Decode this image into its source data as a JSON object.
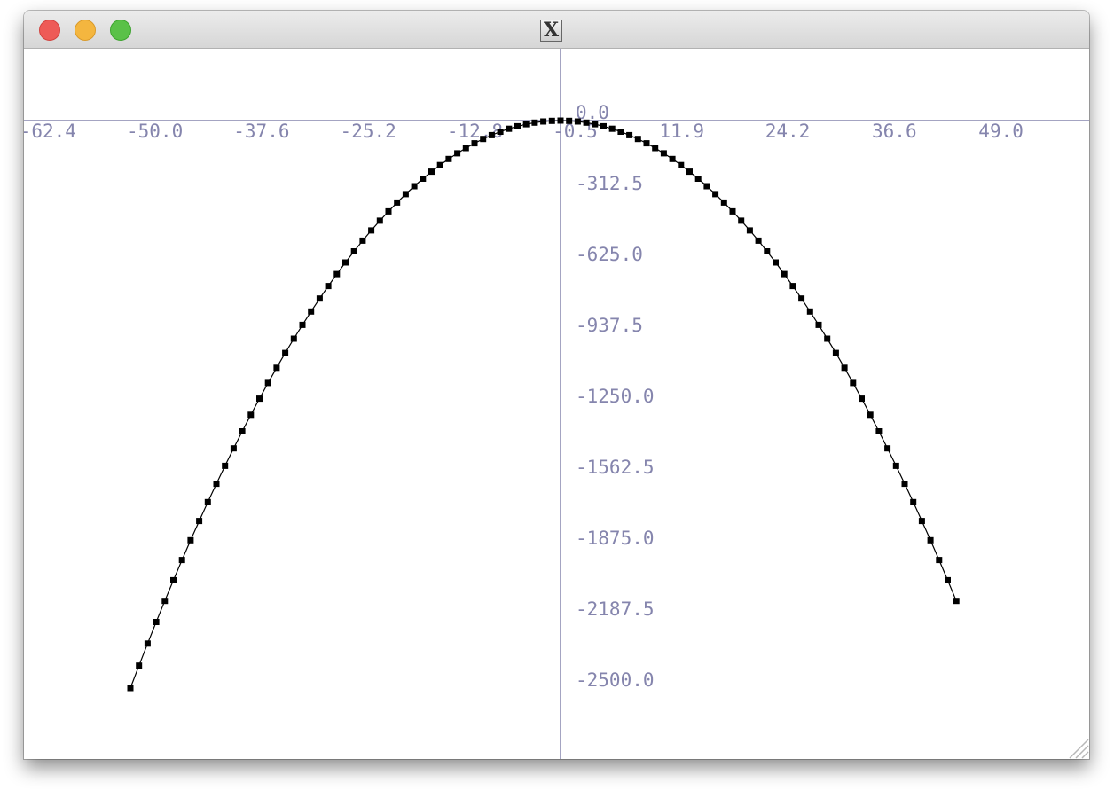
{
  "window": {
    "title_icon_text": "X"
  },
  "colors": {
    "axis": "#8585ad",
    "curve": "#000000",
    "background": "#ffffff"
  },
  "chart_data": {
    "type": "line",
    "title": "",
    "xlabel": "",
    "ylabel": "",
    "xlim": [
      -62.4,
      61.4
    ],
    "ylim": [
      -2700,
      250
    ],
    "grid": false,
    "legend": "none",
    "x_tick_values": [
      -62.4,
      -50.0,
      -37.6,
      -25.2,
      -12.8,
      -0.5,
      11.9,
      24.2,
      36.6,
      49.0
    ],
    "x_tick_labels": [
      "-62.4",
      "-50.0",
      "-37.6",
      "-25.2",
      "-12.8",
      "-0.5",
      "11.9",
      "24.2",
      "36.6",
      "49.0"
    ],
    "y_tick_values": [
      0.0,
      -312.5,
      -625.0,
      -937.5,
      -1250.0,
      -1562.5,
      -1875.0,
      -2187.5,
      -2500.0
    ],
    "y_tick_labels": [
      "0.0",
      "-312.5",
      "-625.0",
      "-937.5",
      "-1250.0",
      "-1562.5",
      "-1875.0",
      "-2187.5",
      "-2500.0"
    ],
    "series": [
      {
        "marker": "square",
        "x_range": [
          -50.0,
          46.0
        ],
        "step": 1.0,
        "equation": "y = -x^2",
        "x": [
          -50,
          -49,
          -48,
          -47,
          -46,
          -45,
          -44,
          -43,
          -42,
          -41,
          -40,
          -39,
          -38,
          -37,
          -36,
          -35,
          -34,
          -33,
          -32,
          -31,
          -30,
          -29,
          -28,
          -27,
          -26,
          -25,
          -24,
          -23,
          -22,
          -21,
          -20,
          -19,
          -18,
          -17,
          -16,
          -15,
          -14,
          -13,
          -12,
          -11,
          -10,
          -9,
          -8,
          -7,
          -6,
          -5,
          -4,
          -3,
          -2,
          -1,
          0,
          1,
          2,
          3,
          4,
          5,
          6,
          7,
          8,
          9,
          10,
          11,
          12,
          13,
          14,
          15,
          16,
          17,
          18,
          19,
          20,
          21,
          22,
          23,
          24,
          25,
          26,
          27,
          28,
          29,
          30,
          31,
          32,
          33,
          34,
          35,
          36,
          37,
          38,
          39,
          40,
          41,
          42,
          43,
          44,
          45,
          46
        ],
        "y": [
          -2500,
          -2401,
          -2304,
          -2209,
          -2116,
          -2025,
          -1936,
          -1849,
          -1764,
          -1681,
          -1600,
          -1521,
          -1444,
          -1369,
          -1296,
          -1225,
          -1156,
          -1089,
          -1024,
          -961,
          -900,
          -841,
          -784,
          -729,
          -676,
          -625,
          -576,
          -529,
          -484,
          -441,
          -400,
          -361,
          -324,
          -289,
          -256,
          -225,
          -196,
          -169,
          -144,
          -121,
          -100,
          -81,
          -64,
          -49,
          -36,
          -25,
          -16,
          -9,
          -4,
          -1,
          0,
          -1,
          -4,
          -9,
          -16,
          -25,
          -36,
          -49,
          -64,
          -81,
          -100,
          -121,
          -144,
          -169,
          -196,
          -225,
          -256,
          -289,
          -324,
          -361,
          -400,
          -441,
          -484,
          -529,
          -576,
          -625,
          -676,
          -729,
          -784,
          -841,
          -900,
          -961,
          -1024,
          -1089,
          -1156,
          -1225,
          -1296,
          -1369,
          -1444,
          -1521,
          -1600,
          -1681,
          -1764,
          -1849,
          -1936,
          -2025,
          -2116
        ]
      }
    ]
  }
}
